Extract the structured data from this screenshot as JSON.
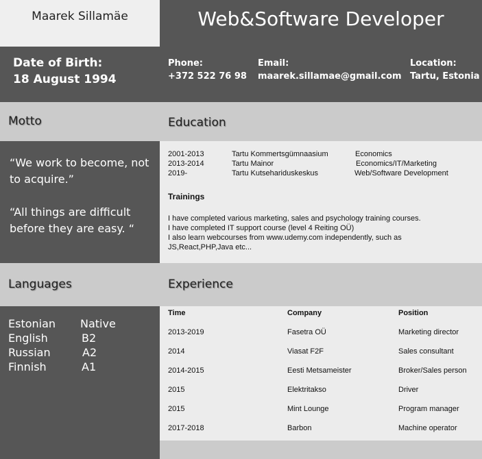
{
  "profile": {
    "name": "Maarek Sillamäe",
    "title": "Web&Software Developer",
    "dob_label": "Date of Birth:",
    "dob_value": "18 August 1994",
    "phone_label": "Phone:",
    "phone_value": "+372 522 76 98",
    "email_label": "Email:",
    "email_value": "maarek.sillamae@gmail.com",
    "location_label": "Location:",
    "location_value": "Tartu, Estonia"
  },
  "sections": {
    "motto": "Motto",
    "education": "Education",
    "languages": "Languages",
    "experience": "Experience"
  },
  "motto": [
    "“We work to become, not to acquire.”",
    "“All things are difficult before they are easy. “"
  ],
  "education": [
    {
      "years": "2001-2013",
      "school": "Tartu Kommertsgümnaasium",
      "field": "Economics"
    },
    {
      "years": "2013-2014",
      "school": "Tartu Mainor",
      "field": "Economics/IT/Marketing"
    },
    {
      "years": "2019-",
      "school": "Tartu Kutsehariduskeskus",
      "field": "Web/Software Development"
    }
  ],
  "trainings": {
    "title": "Trainings",
    "lines": [
      "I have completed various marketing, sales and psychology training courses.",
      "I have completed IT support course (level 4 Reiting OÜ)",
      "I also learn webcourses from www.udemy.com independently, such as JS,React,PHP,Java etc..."
    ]
  },
  "languages": [
    {
      "name": "Estonian",
      "level": "Native"
    },
    {
      "name": "English",
      "level": "B2"
    },
    {
      "name": "Russian",
      "level": "A2"
    },
    {
      "name": "Finnish",
      "level": "A1"
    }
  ],
  "experience": {
    "headers": {
      "time": "Time",
      "company": "Company",
      "position": "Position"
    },
    "rows": [
      {
        "time": "2013-2019",
        "company": "Fasetra OÜ",
        "position": "Marketing director"
      },
      {
        "time": "2014",
        "company": "Viasat F2F",
        "position": "Sales consultant"
      },
      {
        "time": "2014-2015",
        "company": "Eesti Metsameister",
        "position": "Broker/Sales person"
      },
      {
        "time": "2015",
        "company": "Elektritakso",
        "position": "Driver"
      },
      {
        "time": "2015",
        "company": "Mint Lounge",
        "position": "Program manager"
      },
      {
        "time": "2017-2018",
        "company": "Barbon",
        "position": "Machine operator"
      }
    ]
  }
}
